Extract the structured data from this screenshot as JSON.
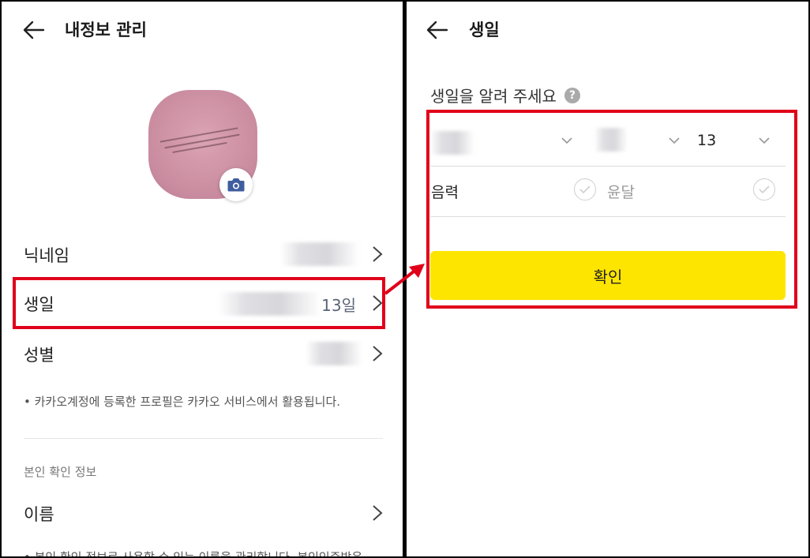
{
  "left_screen": {
    "header": {
      "title": "내정보 관리"
    },
    "profile_rows": [
      {
        "label": "닉네임",
        "value": ""
      },
      {
        "label": "생일",
        "value": "13일"
      },
      {
        "label": "성별",
        "value": ""
      }
    ],
    "profile_note": "• 카카오계정에 등록한 프로필은 카카오 서비스에서 활용됩니다.",
    "verification_section": {
      "title": "본인 확인 정보",
      "rows": [
        {
          "label": "이름"
        }
      ],
      "note_partial": "• 본인 확인 정보로 사용할 수 있는 이름을 관리합니다. 본인인증받은"
    }
  },
  "right_screen": {
    "header": {
      "title": "생일"
    },
    "prompt": "생일을 알려 주세요",
    "help_icon": "?",
    "selects": [
      {
        "name": "year",
        "value": ""
      },
      {
        "name": "month",
        "value": ""
      },
      {
        "name": "day",
        "value": "13"
      }
    ],
    "calendar_options": [
      {
        "label": "음력",
        "checked": false
      },
      {
        "label": "윤달",
        "checked": false
      }
    ],
    "confirm_label": "확인"
  },
  "colors": {
    "highlight_red": "#e0001a",
    "confirm_yellow": "#fee500",
    "camera_blue": "#3f5d9e",
    "avatar_pink": "#c98b9f"
  },
  "icons": [
    "back-arrow-icon",
    "camera-icon",
    "chevron-right-icon",
    "chevron-down-icon",
    "check-icon",
    "help-icon"
  ]
}
